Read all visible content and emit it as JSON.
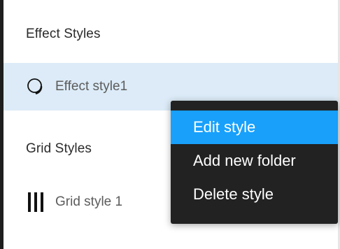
{
  "sections": {
    "effect_header": "Effect Styles",
    "grid_header": "Grid Styles"
  },
  "effect_style": {
    "label": "Effect style1",
    "icon": "effect-drop-shadow-icon",
    "selected": true
  },
  "grid_style": {
    "label": "Grid style 1",
    "icon": "grid-columns-icon"
  },
  "context_menu": {
    "items": [
      {
        "label": "Edit style",
        "highlighted": true
      },
      {
        "label": "Add new folder",
        "highlighted": false
      },
      {
        "label": "Delete style",
        "highlighted": false
      }
    ]
  },
  "colors": {
    "selection_bg": "#dcebf7",
    "menu_bg": "#222222",
    "menu_highlight": "#18a0fb"
  }
}
